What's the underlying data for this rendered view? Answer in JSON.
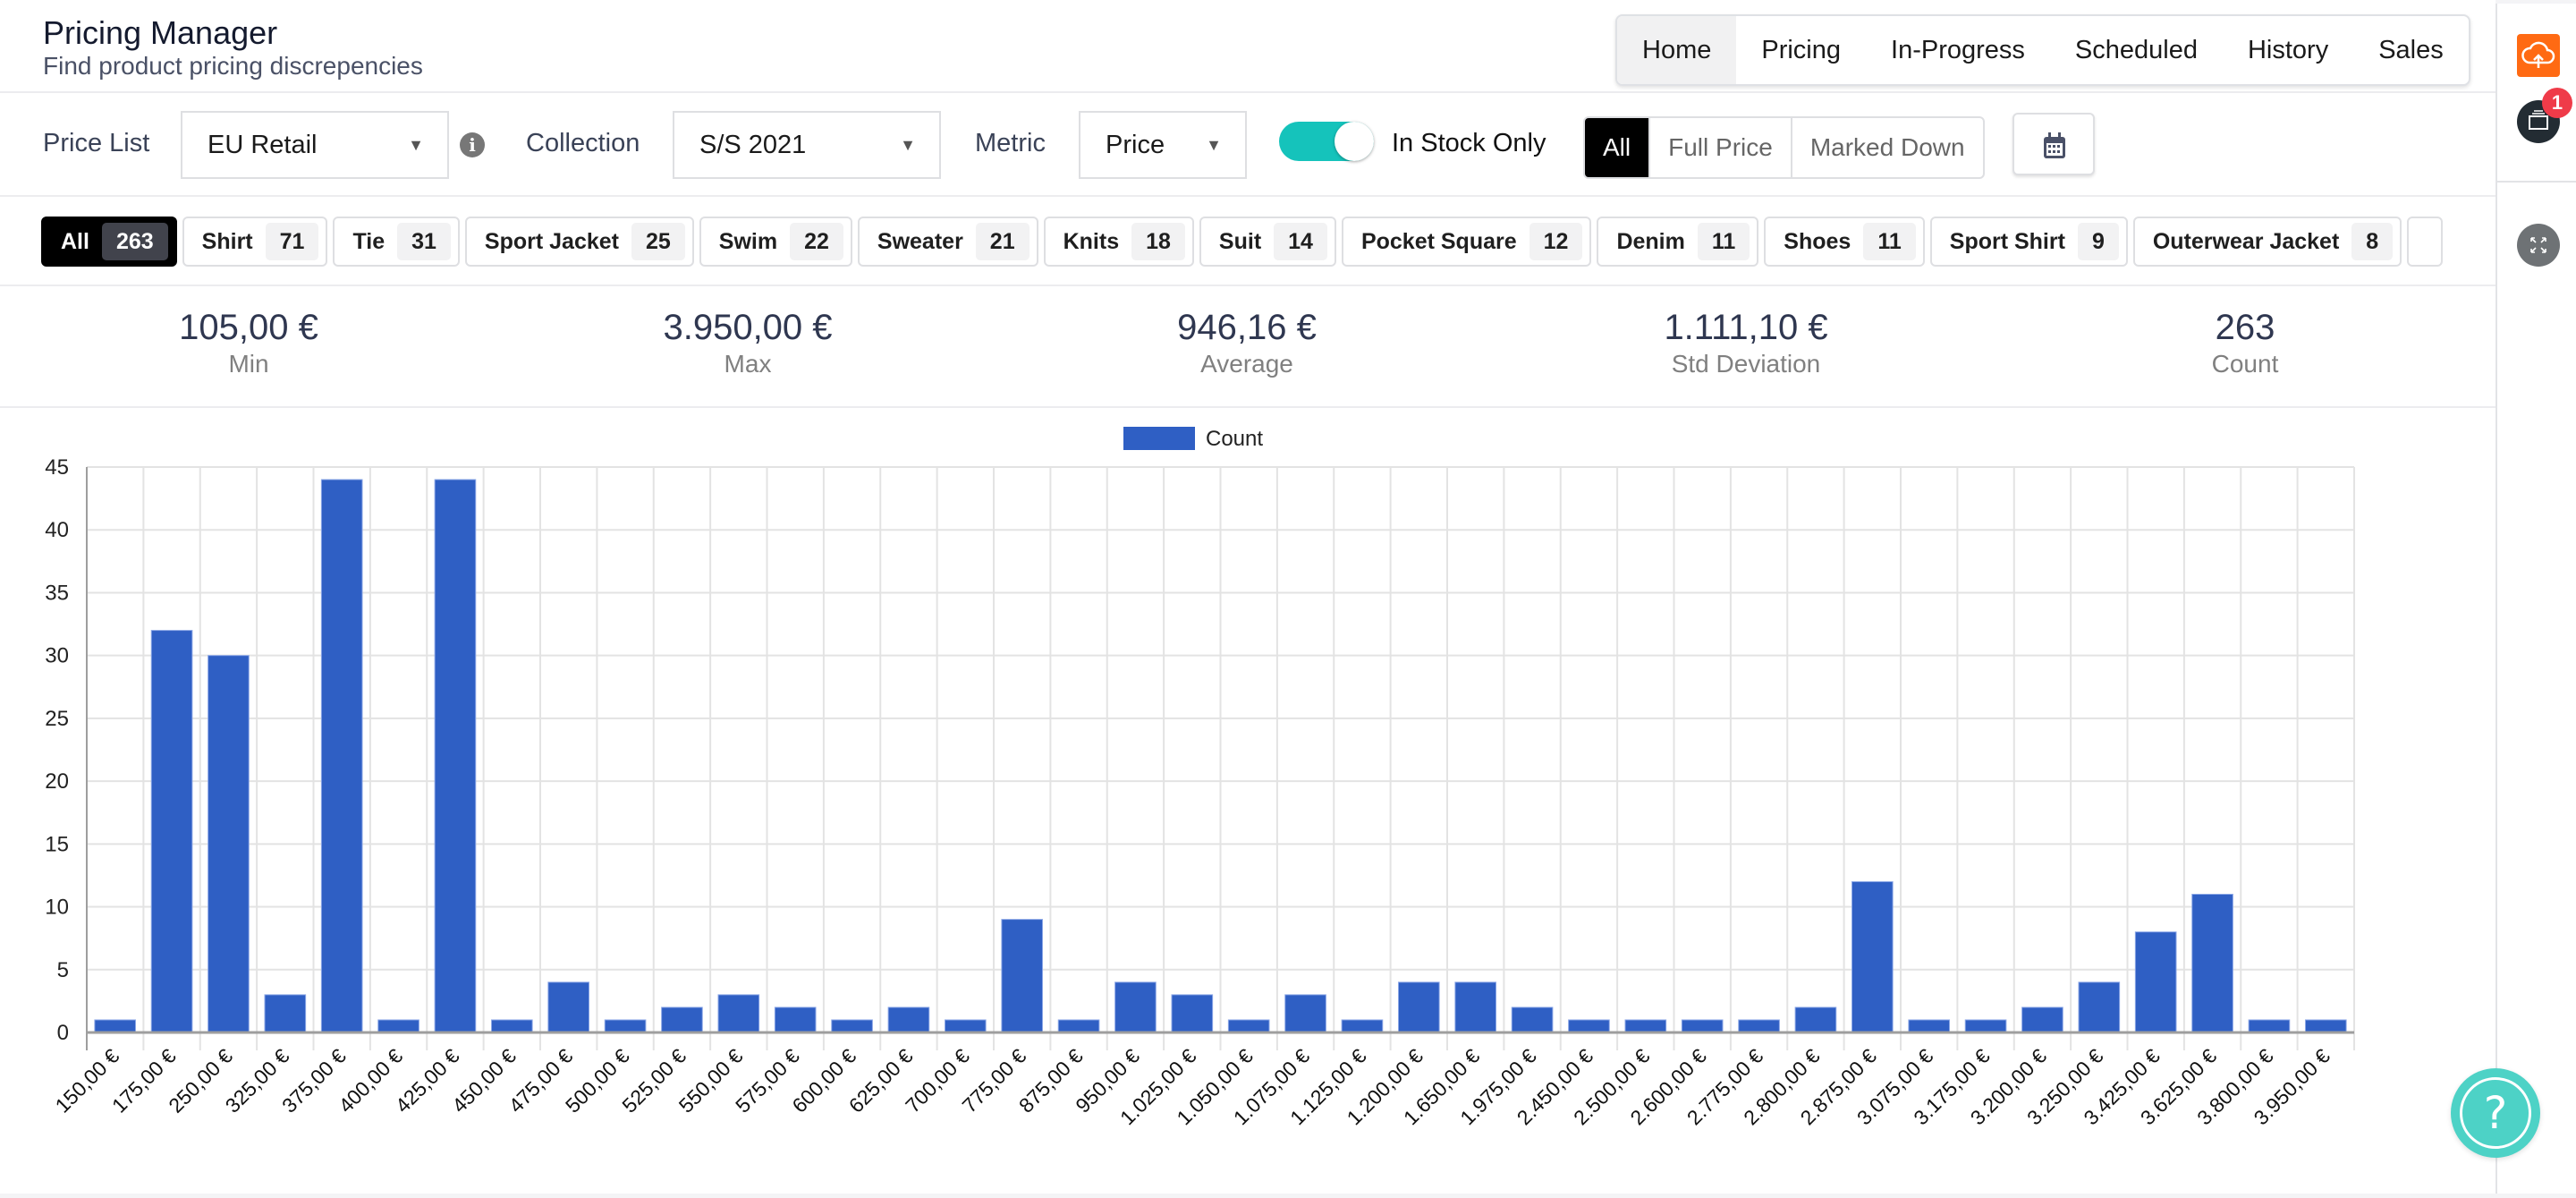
{
  "header": {
    "title": "Pricing Manager",
    "subtitle": "Find product pricing discrepencies",
    "nav": [
      {
        "label": "Home",
        "active": true
      },
      {
        "label": "Pricing",
        "active": false
      },
      {
        "label": "In-Progress",
        "active": false
      },
      {
        "label": "Scheduled",
        "active": false
      },
      {
        "label": "History",
        "active": false
      },
      {
        "label": "Sales",
        "active": false
      }
    ]
  },
  "filters": {
    "price_list_label": "Price List",
    "price_list_value": "EU Retail",
    "collection_label": "Collection",
    "collection_value": "S/S 2021",
    "metric_label": "Metric",
    "metric_value": "Price",
    "in_stock_label": "In Stock Only",
    "in_stock_on": true,
    "price_type": [
      {
        "label": "All",
        "active": true
      },
      {
        "label": "Full Price",
        "active": false
      },
      {
        "label": "Marked Down",
        "active": false
      }
    ],
    "icons": {
      "info": "info-icon",
      "calendar": "calendar-icon",
      "caret": "▾"
    }
  },
  "categories": [
    {
      "label": "All",
      "count": "263",
      "active": true
    },
    {
      "label": "Shirt",
      "count": "71"
    },
    {
      "label": "Tie",
      "count": "31"
    },
    {
      "label": "Sport Jacket",
      "count": "25"
    },
    {
      "label": "Swim",
      "count": "22"
    },
    {
      "label": "Sweater",
      "count": "21"
    },
    {
      "label": "Knits",
      "count": "18"
    },
    {
      "label": "Suit",
      "count": "14"
    },
    {
      "label": "Pocket Square",
      "count": "12"
    },
    {
      "label": "Denim",
      "count": "11"
    },
    {
      "label": "Shoes",
      "count": "11"
    },
    {
      "label": "Sport Shirt",
      "count": "9"
    },
    {
      "label": "Outerwear Jacket",
      "count": "8"
    }
  ],
  "stats": [
    {
      "value": "105,00 €",
      "label": "Min"
    },
    {
      "value": "3.950,00 €",
      "label": "Max"
    },
    {
      "value": "946,16 €",
      "label": "Average"
    },
    {
      "value": "1.111,10 €",
      "label": "Std Deviation"
    },
    {
      "value": "263",
      "label": "Count"
    }
  ],
  "rail": {
    "upload": "cloud-upload-icon",
    "inbox": "inbox-icon",
    "badge": "1",
    "expand": "expand-icon",
    "help": "?"
  },
  "chart_data": {
    "type": "bar",
    "title": "",
    "xlabel": "",
    "ylabel": "",
    "legend": {
      "position": "top",
      "entries": [
        "Count"
      ]
    },
    "color": "#2f5fc4",
    "grid": true,
    "ylim": [
      0,
      45
    ],
    "yticks": [
      0,
      5,
      10,
      15,
      20,
      25,
      30,
      35,
      40,
      45
    ],
    "categories": [
      "150,00 €",
      "175,00 €",
      "250,00 €",
      "325,00 €",
      "375,00 €",
      "400,00 €",
      "425,00 €",
      "450,00 €",
      "475,00 €",
      "500,00 €",
      "525,00 €",
      "550,00 €",
      "575,00 €",
      "600,00 €",
      "625,00 €",
      "700,00 €",
      "775,00 €",
      "875,00 €",
      "950,00 €",
      "1.025,00 €",
      "1.050,00 €",
      "1.075,00 €",
      "1.125,00 €",
      "1.200,00 €",
      "1.650,00 €",
      "1.975,00 €",
      "2.450,00 €",
      "2.500,00 €",
      "2.600,00 €",
      "2.775,00 €",
      "2.800,00 €",
      "2.875,00 €",
      "3.075,00 €",
      "3.175,00 €",
      "3.200,00 €",
      "3.250,00 €",
      "3.425,00 €",
      "3.625,00 €",
      "3.800,00 €",
      "3.950,00 €"
    ],
    "series": [
      {
        "name": "Count",
        "values": [
          1,
          32,
          30,
          3,
          44,
          1,
          44,
          1,
          4,
          1,
          2,
          3,
          2,
          1,
          2,
          1,
          9,
          1,
          4,
          3,
          1,
          3,
          1,
          4,
          4,
          2,
          1,
          1,
          1,
          1,
          2,
          12,
          1,
          1,
          2,
          4,
          8,
          11,
          1,
          1
        ]
      }
    ]
  }
}
